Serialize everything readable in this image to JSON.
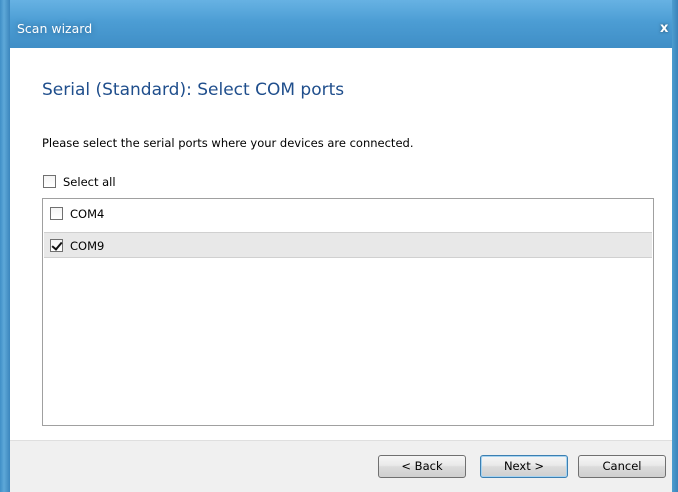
{
  "window": {
    "title": "Scan wizard",
    "close_glyph": "x"
  },
  "page": {
    "title": "Serial (Standard): Select COM ports",
    "instructions": "Please select the serial ports where your devices are connected."
  },
  "select_all": {
    "label": "Select all",
    "checked": false
  },
  "ports": [
    {
      "label": "COM4",
      "checked": false,
      "selected": false
    },
    {
      "label": "COM9",
      "checked": true,
      "selected": true
    }
  ],
  "buttons": {
    "back": "< Back",
    "next": "Next >",
    "cancel": "Cancel"
  },
  "colors": {
    "title_blue": "#1f4e8c",
    "frame_blue": "#4c9dd4"
  }
}
